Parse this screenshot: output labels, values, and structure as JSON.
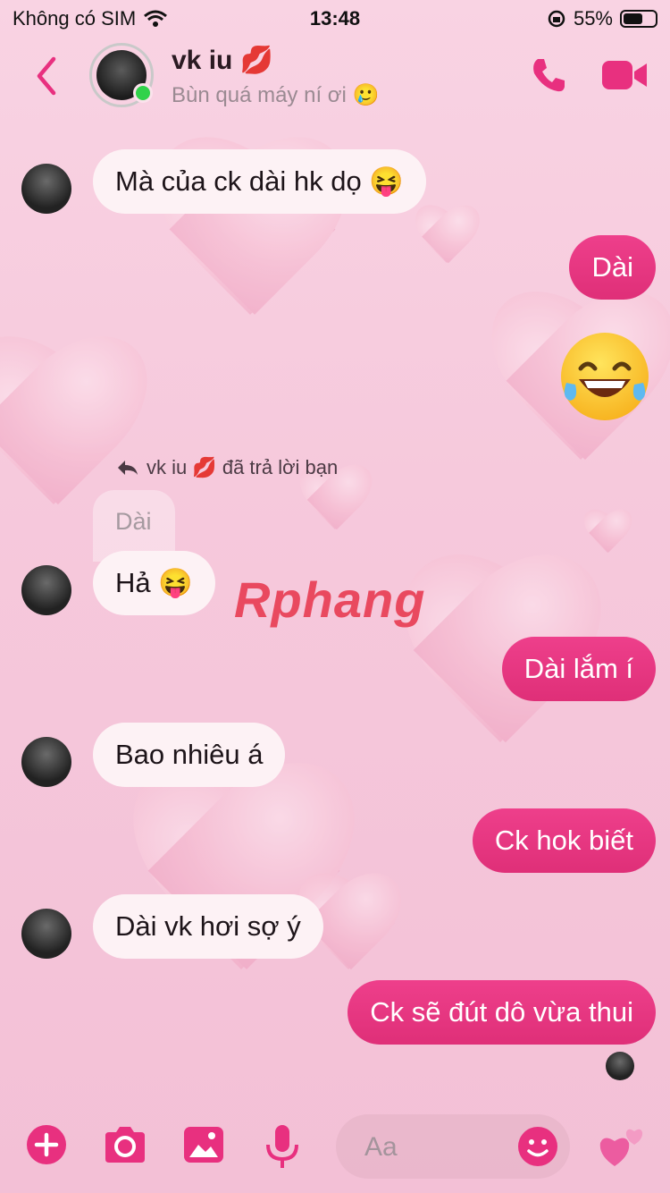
{
  "status_bar": {
    "carrier": "Không có SIM",
    "time": "13:48",
    "battery": "55%",
    "battery_level": 0.55
  },
  "header": {
    "contact_name": "vk iu 💋",
    "contact_status": "Bùn quá máy ní ơi 🥲"
  },
  "messages": [
    {
      "side": "in",
      "text": "Mà của ck dài hk dọ 😝"
    },
    {
      "side": "out",
      "text": "Dài"
    },
    {
      "side": "out",
      "text": "😂"
    },
    {
      "side": "in",
      "reply_meta": "vk iu 💋  đã trả lời bạn",
      "quoted": "Dài",
      "text": "Hả 😝"
    },
    {
      "side": "out",
      "text": "Dài lắm í"
    },
    {
      "side": "in",
      "text": "Bao nhiêu á"
    },
    {
      "side": "out",
      "text": "Ck hok biết"
    },
    {
      "side": "in",
      "text": "Dài vk hơi sợ ý"
    },
    {
      "side": "out",
      "text": "Ck sẽ đút dô vừa thui"
    }
  ],
  "watermark": {
    "part1": "Rphang",
    "part2": ""
  },
  "composer": {
    "placeholder": "Aa"
  },
  "colors": {
    "accent": "#e8307f",
    "online": "#31d24a"
  },
  "icons": [
    "back-chevron-icon",
    "phone-icon",
    "video-camera-icon",
    "plus-icon",
    "camera-icon",
    "gallery-icon",
    "microphone-icon",
    "emoji-icon",
    "hearts-icon",
    "reply-arrow-icon"
  ]
}
